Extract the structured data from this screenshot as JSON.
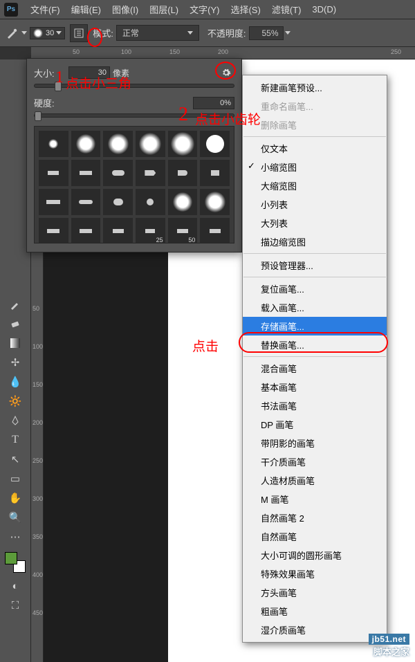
{
  "menu": {
    "items": [
      "文件(F)",
      "编辑(E)",
      "图像(I)",
      "图层(L)",
      "文字(Y)",
      "选择(S)",
      "滤镜(T)",
      "3D(D)"
    ]
  },
  "optionbar": {
    "brush_size": "30",
    "mode_label": "模式:",
    "mode_value": "正常",
    "opacity_label": "不透明度:",
    "opacity_value": "55%"
  },
  "ruler_h": {
    "t50": "50",
    "t100": "100",
    "t150": "150",
    "t200": "200",
    "t250": "250"
  },
  "ruler_v": {
    "t50": "50",
    "t100": "100",
    "t150": "150",
    "t200": "200",
    "t250": "250",
    "t300": "300",
    "t350": "350",
    "t400": "400",
    "t450": "450"
  },
  "brush_panel": {
    "size_label": "大小:",
    "size_value": "30",
    "size_unit": "像素",
    "hard_label": "硬度:",
    "hard_value": "0%",
    "preset_25": "25",
    "preset_50": "50"
  },
  "flyout": {
    "new": "新建画笔预设...",
    "rename": "重命名画笔...",
    "delete": "删除画笔",
    "text_only": "仅文本",
    "small_thumb": "小缩览图",
    "large_thumb": "大缩览图",
    "small_list": "小列表",
    "large_list": "大列表",
    "stroke_thumb": "描边缩览图",
    "preset_mgr": "预设管理器...",
    "reset": "复位画笔...",
    "load": "载入画笔...",
    "save": "存储画笔...",
    "replace": "替换画笔...",
    "mix": "混合画笔",
    "basic": "基本画笔",
    "calli": "书法画笔",
    "dp": "DP 画笔",
    "shadow": "带阴影的画笔",
    "dry": "干介质画笔",
    "faux": "人造材质画笔",
    "m": "M 画笔",
    "nat2": "自然画笔 2",
    "nat": "自然画笔",
    "round": "大小可调的圆形画笔",
    "fx": "特殊效果画笔",
    "square": "方头画笔",
    "thick": "粗画笔",
    "wet": "湿介质画笔"
  },
  "annotations": {
    "a1_num": "1",
    "a1": "点击小三角",
    "a2_num": "2",
    "a2": "点击小齿轮",
    "a3": "点击"
  },
  "watermark": {
    "line1": "jb51.net",
    "line2": "脚本之家"
  }
}
